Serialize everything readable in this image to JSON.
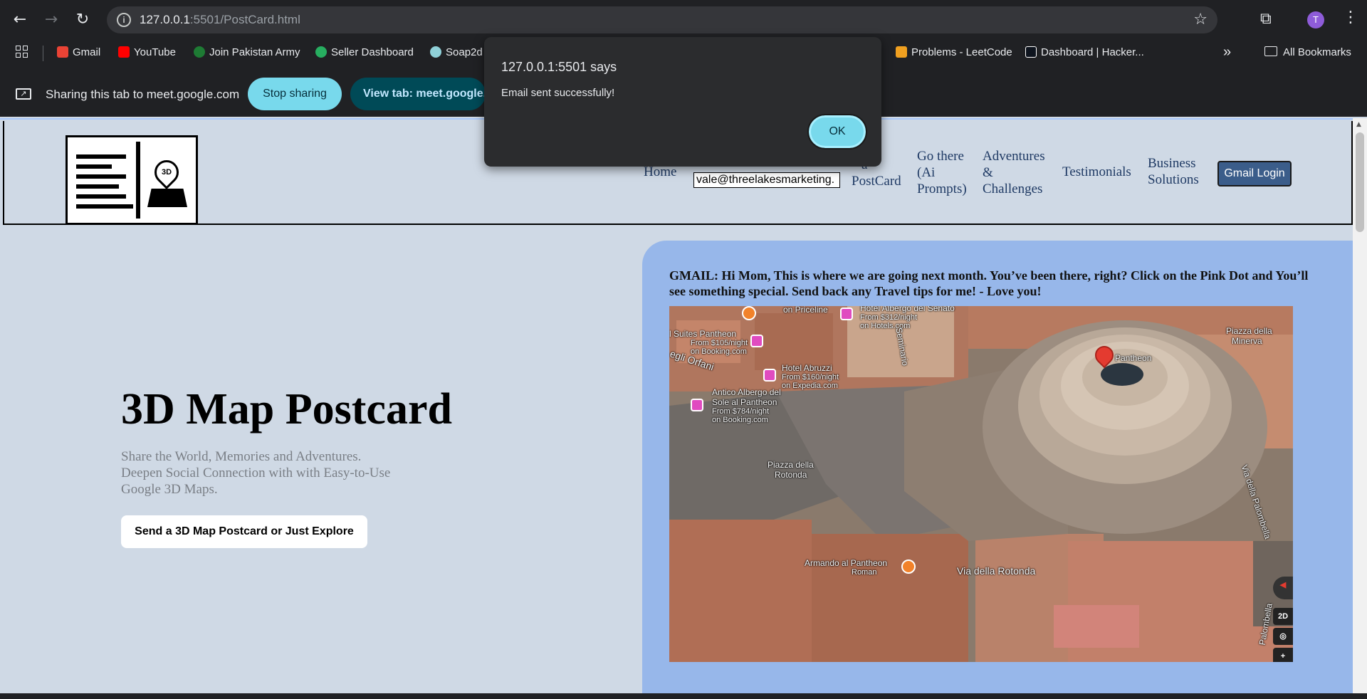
{
  "browser": {
    "url_host": "127.0.0.1",
    "url_rest": ":5501/PostCard.html",
    "profile_initial": "T",
    "bookmarks": [
      {
        "label": "Gmail",
        "color": "#ea4335"
      },
      {
        "label": "YouTube",
        "color": "#ff0000"
      },
      {
        "label": "Join Pakistan Army",
        "color": "#1e7b34"
      },
      {
        "label": "Seller Dashboard",
        "color": "#27ae60"
      },
      {
        "label": "Soap2d",
        "color": "#8fd0d8"
      },
      {
        "label": "Problems - LeetCode",
        "color": "#f0a020"
      },
      {
        "label": "Dashboard | Hacker...",
        "color": "#0e141e"
      }
    ],
    "all_bookmarks": "All Bookmarks",
    "overflow_label": "»"
  },
  "sharing": {
    "text": "Sharing this tab to meet.google.com",
    "stop_label": "Stop sharing",
    "view_label": "View tab: meet.google.com"
  },
  "dialog": {
    "title": "127.0.0.1:5501 says",
    "message": "Email sent successfully!",
    "ok_label": "OK"
  },
  "nav": {
    "home": "Home",
    "email_value": "vale@threelakesmarketing.",
    "postcard_line1": "a",
    "postcard_line2": "PostCard",
    "go_there": [
      "Go there",
      "(Ai",
      "Prompts)"
    ],
    "adventures": [
      "Adventures",
      "&",
      "Challenges"
    ],
    "testimonials": "Testimonials",
    "business": [
      "Business",
      "Solutions"
    ],
    "gmail_login": "Gmail Login"
  },
  "hero": {
    "title": "3D Map Postcard",
    "subtitle": "Share the World, Memories and Adventures. Deepen Social Connection with with Easy-to-Use Google 3D Maps.",
    "cta": "Send a 3D Map Postcard or Just Explore"
  },
  "card": {
    "message": "GMAIL: Hi Mom, This is where we are going next month. You’ve been there, right? Click on the Pink Dot and You’ll see something special. Send back any Travel tips for me! - Love you!"
  },
  "map": {
    "labels": {
      "priceline": "on Priceline",
      "senato_name": "Hotel Albergo del Senato",
      "senato_price": "From $312/night",
      "senato_src": "on Hotels.com",
      "suites": "l Suites Pantheon",
      "suites_price": "From $105/night",
      "suites_src": "on Booking.com",
      "orfani": "egli Orfani",
      "seminario": "Seminario",
      "abruzzi": "Hotel Abruzzi",
      "abruzzi_price": "From $160/night",
      "abruzzi_src": "on Expedia.com",
      "antico1": "Antico Albergo del",
      "antico2": "Sole al Pantheon",
      "antico_price": "From $784/night",
      "antico_src": "on Booking.com",
      "pantheon": "Pantheon",
      "minerva1": "Piazza della",
      "minerva2": "Minerva",
      "rotonda_piazza1": "Piazza della",
      "rotonda_piazza2": "Rotonda",
      "palombella": "Via della Palombella",
      "armando": "Armando al Pantheon",
      "roman": "Roman",
      "via_rotonda": "Via della Rotonda",
      "palombella2": "Palombella",
      "btn_2d": "2D"
    }
  }
}
